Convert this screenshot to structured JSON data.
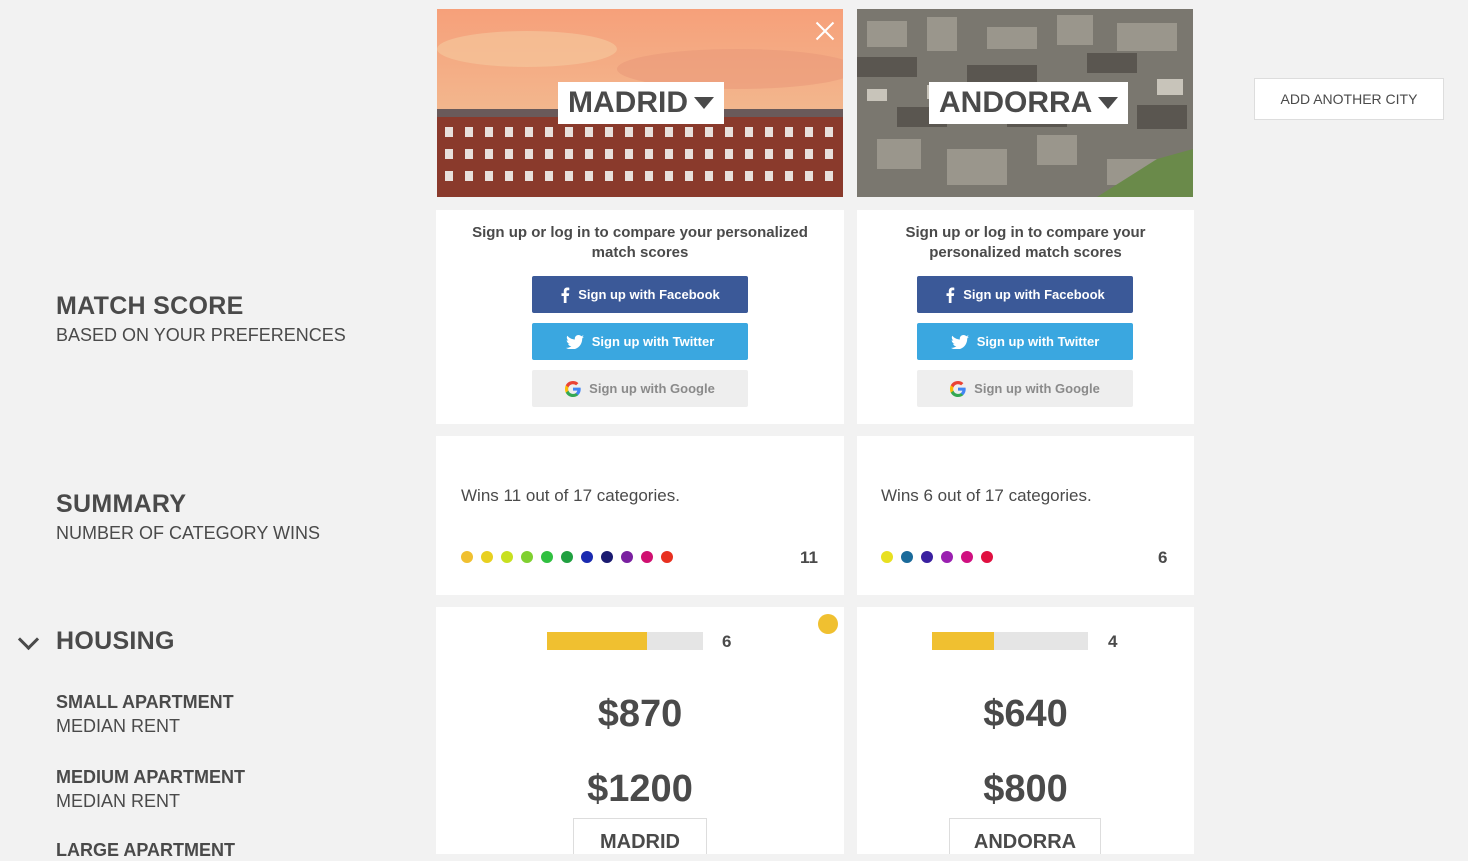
{
  "sections": {
    "match_score": {
      "title": "MATCH SCORE",
      "subtitle": "BASED ON YOUR PREFERENCES"
    },
    "summary": {
      "title": "SUMMARY",
      "subtitle": "NUMBER OF CATEGORY WINS"
    },
    "housing": {
      "title": "HOUSING"
    }
  },
  "housing_rows": [
    {
      "title": "SMALL APARTMENT",
      "subtitle": "MEDIAN RENT"
    },
    {
      "title": "MEDIUM APARTMENT",
      "subtitle": "MEDIAN RENT"
    },
    {
      "title": "LARGE APARTMENT"
    }
  ],
  "add_city_label": "ADD ANOTHER CITY",
  "signup": {
    "prompt": "Sign up or log in to compare your personalized match scores",
    "facebook": "Sign up with Facebook",
    "twitter": "Sign up with Twitter",
    "google": "Sign up with Google"
  },
  "cities": [
    {
      "name": "MADRID",
      "wins_text": "Wins 11 out of 17 categories.",
      "wins_count": "11",
      "win_dot_colors": [
        "#f0c030",
        "#e8d020",
        "#c8e020",
        "#80d030",
        "#30c040",
        "#20a040",
        "#1a2ab0",
        "#1a1a70",
        "#7a20a0",
        "#d01070",
        "#e83020"
      ],
      "housing_score": "6",
      "housing_fraction": 0.64,
      "small_rent": "$870",
      "medium_rent": "$1200",
      "winner_dot_color": "#f0c030"
    },
    {
      "name": "ANDORRA",
      "wins_text": "Wins 6 out of 17 categories.",
      "wins_count": "6",
      "win_dot_colors": [
        "#e8e020",
        "#1a6a9a",
        "#3a20a0",
        "#9a20b0",
        "#d01080",
        "#e01040"
      ],
      "housing_score": "4",
      "housing_fraction": 0.4,
      "small_rent": "$640",
      "medium_rent": "$800"
    }
  ],
  "colors": {
    "facebook": "#3b5998",
    "twitter": "#3aa7e0",
    "bar_fill": "#f0c030",
    "background": "#f2f2f2"
  }
}
